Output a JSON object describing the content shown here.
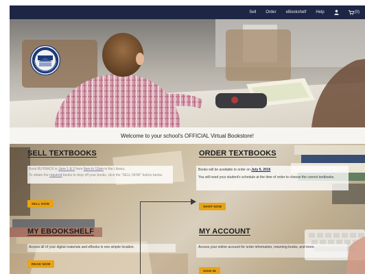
{
  "nav": {
    "links": [
      "Sell",
      "Order",
      "eBookshelf",
      "Help"
    ],
    "cart_count": "(0)",
    "user_icon": "user-icon",
    "cart_icon": "cart-icon"
  },
  "hero": {
    "seal_icon": "school-seal-logo"
  },
  "welcome": {
    "text": "Welcome to your school's OFFICIAL Virtual Bookstore!"
  },
  "tiles": {
    "sell": {
      "title": "SELL TEXTBOOKS",
      "line1_pre": "Book BUYBACK is",
      "line1_date": "June 1 & 2",
      "line1_mid": "from",
      "line1_time": "9am to 12pm",
      "line1_post": "in the Library.",
      "line2": "To obtain the",
      "line2_req": "required",
      "line2_post": "books to drop off your books, click the \"SELL NOW\" button below.",
      "button": "SELL NOW"
    },
    "order": {
      "title": "ORDER TEXTBOOKS",
      "line1_pre": "Books will be available to order on",
      "line1_date": "July 5, 2016",
      "line2": "You will need your student's schedule at the time of order to choose the correct textbooks.",
      "button": "SHOP NOW"
    },
    "ebookshelf": {
      "title": "MY EBOOKSHELF",
      "text": "Access all of your digital materials and eBooks in one simple location.",
      "button": "READ NOW"
    },
    "account": {
      "title": "MY ACCOUNT",
      "text": "Access your online account for order information, returning books, and more.",
      "button": "SIGN IN"
    }
  }
}
